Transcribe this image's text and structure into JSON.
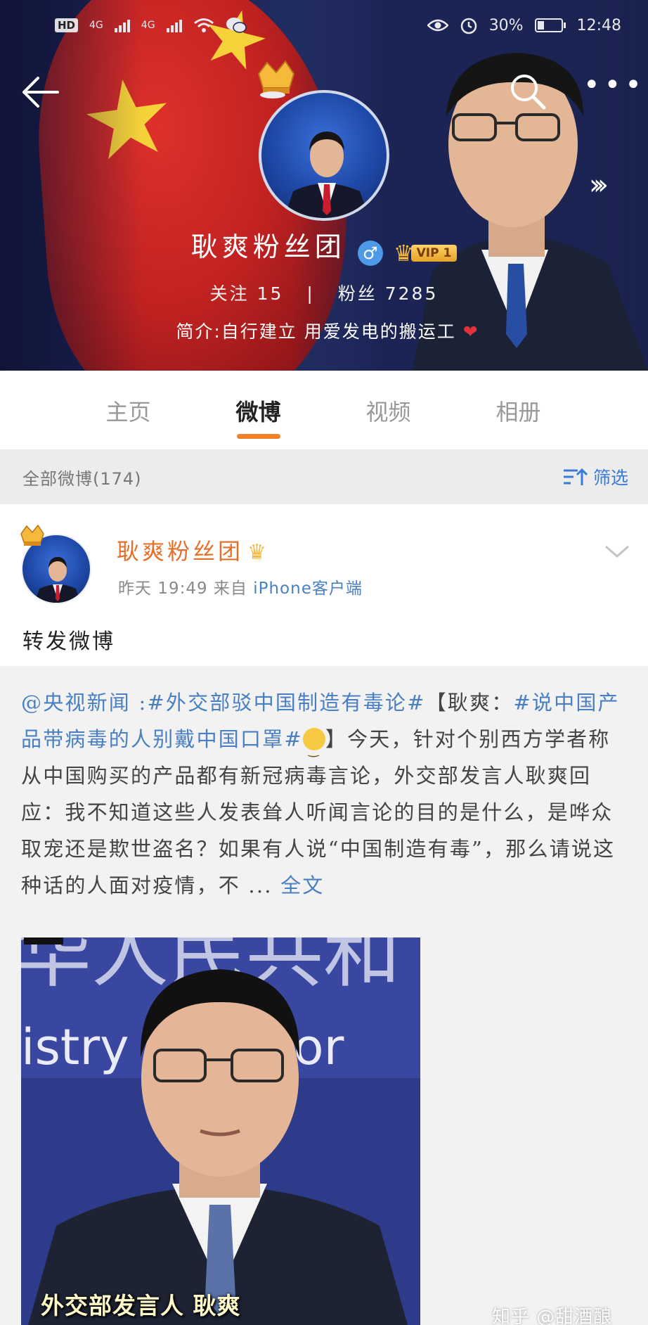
{
  "status_bar": {
    "left_tag": "HD",
    "net1": "4G",
    "net2": "4G",
    "battery_percent_text": "30%",
    "battery_level": 0.3,
    "time": "12:48"
  },
  "profile": {
    "name": "耿爽粉丝团",
    "gender_icon": "male-icon",
    "vip_label": "VIP 1",
    "following_label": "关注",
    "following_count": "15",
    "followers_label": "粉丝",
    "followers_count": "7285",
    "bio": "简介:自行建立 用爱发电的搬运工"
  },
  "tabs": [
    {
      "label": "主页",
      "active": false
    },
    {
      "label": "微博",
      "active": true
    },
    {
      "label": "视频",
      "active": false
    },
    {
      "label": "相册",
      "active": false
    }
  ],
  "filter": {
    "count_text": "全部微博(174)",
    "filter_label": "筛选"
  },
  "post": {
    "author": "耿爽粉丝团",
    "time": "昨天 19:49",
    "from_label": "来自",
    "source": "iPhone客户端",
    "text": "转发微博"
  },
  "repost": {
    "mention": "@央视新闻",
    "topic1": ":#外交部驳中国制造有毒论#",
    "bracket_open": "【耿爽：",
    "topic2": "#说中国产品带病毒的人别戴中国口罩#",
    "body": "】今天，针对个别西方学者称从中国购买的产品都有新冠病毒言论，外交部发言人耿爽回应：我不知道这些人发表耸人听闻言论的目的是什么，是哗众取宠还是欺世盗名？如果有人说“中国制造有毒”，那么请说这种话的人面对疫情，不 ...",
    "full_text_link": "全文",
    "image_caption": "外交部发言人 耿爽"
  },
  "watermark": "知乎 @甜酒酿",
  "colors": {
    "accent_orange": "#f2822a",
    "link_blue": "#4a7fc2",
    "author_orange": "#e4712b"
  }
}
